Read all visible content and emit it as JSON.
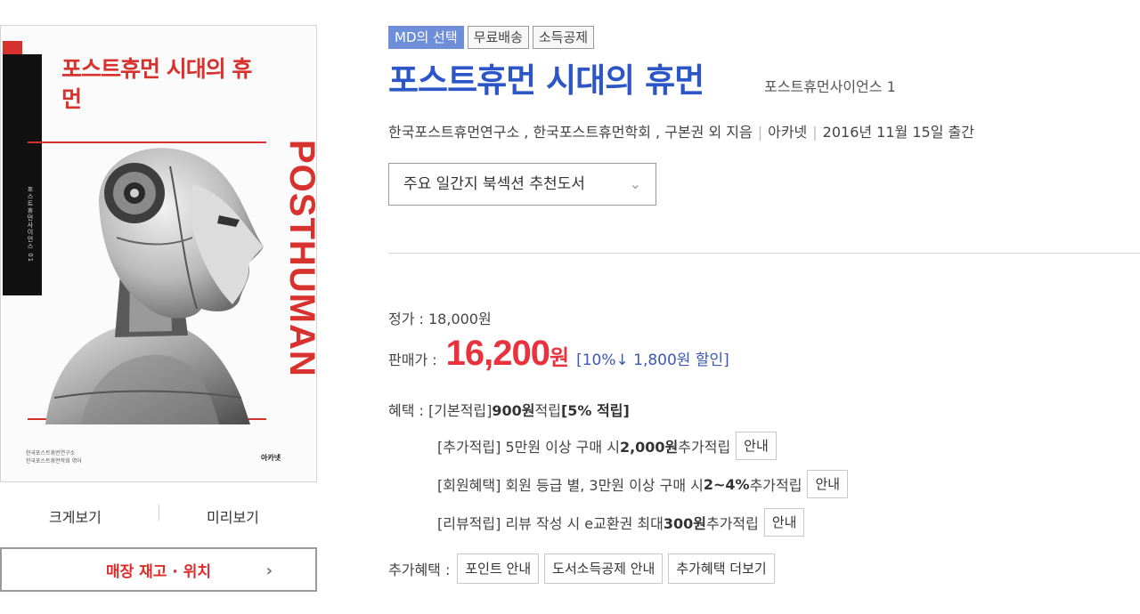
{
  "cover": {
    "title": "포스트휴먼 시대의 휴먼",
    "spine_text": "포스트휴먼사이언스 01",
    "vertical_text": "POSTHUMAN",
    "authors": [
      "한국포스트휴먼연구소",
      "한국포스트휴먼학회 엮어"
    ],
    "publisher_mark": "아카넷"
  },
  "left": {
    "zoom_label": "크게보기",
    "preview_label": "미리보기",
    "store_button": "매장 재고 · 위치",
    "chevron": "›"
  },
  "badges": [
    "MD의 선택",
    "무료배송",
    "소득공제"
  ],
  "book": {
    "title": "포스트휴먼 시대의 휴먼",
    "series": "포스트휴먼사이언스 1",
    "authors": "한국포스트휴먼연구소 , 한국포스트휴먼학회 , 구본권 외 지음",
    "publisher": "아카넷",
    "pub_date": "2016년 11월 15일 출간"
  },
  "recommend_select": "주요 일간지 북섹션 추천도서",
  "price": {
    "list_label": "정가 : 18,000원",
    "sale_label": "판매가 :",
    "sale_value": "16,200",
    "sale_unit": "원",
    "discount": "[10%↓ 1,800원 할인]"
  },
  "benefits": {
    "label": "혜택 :",
    "basic_pre": "[기본적립] ",
    "basic_bold1": "900원",
    "basic_mid": " 적립 ",
    "basic_bold2": "[5% 적립]",
    "add_pre": "[추가적립] 5만원 이상 구매 시 ",
    "add_bold": "2,000원",
    "add_post": " 추가적립",
    "member_pre": "[회원혜택] 회원 등급 별, 3만원 이상 구매 시 ",
    "member_bold": "2~4%",
    "member_post": " 추가적립",
    "review_pre": "[리뷰적립] 리뷰 작성 시 e교환권 최대 ",
    "review_bold": "300원",
    "review_post": " 추가적립",
    "info_label": "안내"
  },
  "extra": {
    "label": "추가혜택 :",
    "buttons": [
      "포인트 안내",
      "도서소득공제 안내",
      "추가혜택 더보기"
    ]
  }
}
